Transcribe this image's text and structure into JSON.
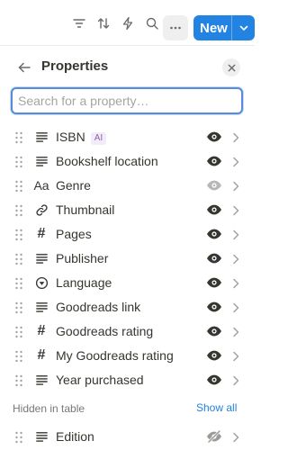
{
  "toolbar": {
    "icons": [
      "filter-icon",
      "sort-icon",
      "automation-icon",
      "search-icon",
      "more-icon"
    ],
    "new_label": "New"
  },
  "panel": {
    "title": "Properties",
    "search_placeholder": "Search for a property…"
  },
  "properties": [
    {
      "label": "ISBN",
      "type_icon": "text-icon",
      "badge": "AI",
      "visible": true
    },
    {
      "label": "Bookshelf location",
      "type_icon": "text-icon",
      "visible": true
    },
    {
      "label": "Genre",
      "type_icon": "title-icon",
      "type_glyph": "Aa",
      "visible": true,
      "eye_dim": true
    },
    {
      "label": "Thumbnail",
      "type_icon": "link-icon",
      "visible": true
    },
    {
      "label": "Pages",
      "type_icon": "number-icon",
      "type_glyph": "#",
      "visible": true
    },
    {
      "label": "Publisher",
      "type_icon": "text-icon",
      "visible": true
    },
    {
      "label": "Language",
      "type_icon": "select-icon",
      "visible": true
    },
    {
      "label": "Goodreads link",
      "type_icon": "text-icon",
      "visible": true
    },
    {
      "label": "Goodreads rating",
      "type_icon": "number-icon",
      "type_glyph": "#",
      "visible": true
    },
    {
      "label": "My Goodreads rating",
      "type_icon": "number-icon",
      "type_glyph": "#",
      "visible": true
    },
    {
      "label": "Year purchased",
      "type_icon": "text-icon",
      "visible": true
    }
  ],
  "hidden_section": {
    "label": "Hidden in table",
    "action": "Show all",
    "items": [
      {
        "label": "Edition",
        "type_icon": "text-icon",
        "visible": false
      }
    ]
  },
  "colors": {
    "accent": "#2383e2",
    "text": "#37352f",
    "muted": "#787774",
    "ai_badge_bg": "#f2ebf8",
    "ai_badge_fg": "#9065b0"
  }
}
